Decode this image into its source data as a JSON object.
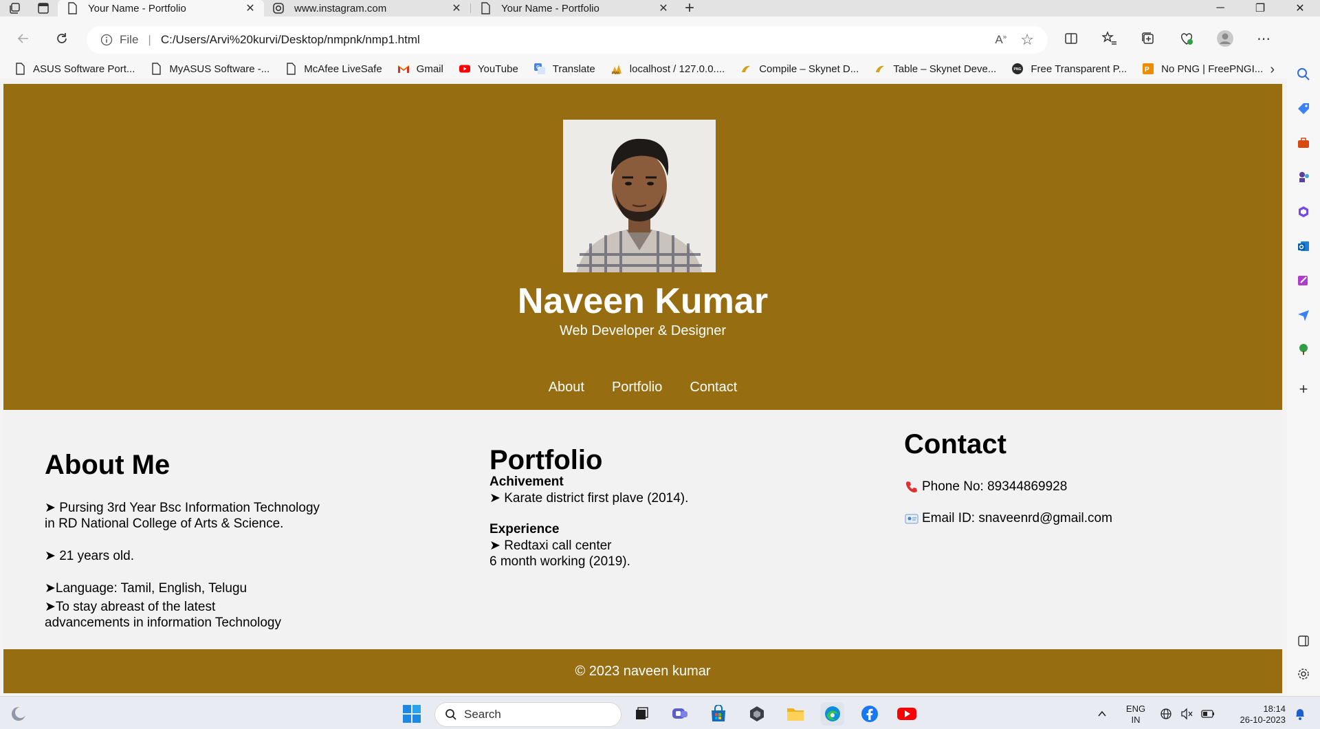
{
  "browser": {
    "tabs": [
      {
        "title": "Your Name - Portfolio",
        "active": true
      },
      {
        "title": "www.instagram.com",
        "active": false
      },
      {
        "title": "Your Name - Portfolio",
        "active": false
      }
    ],
    "address": {
      "scheme_label": "File",
      "url": "C:/Users/Arvi%20kurvi/Desktop/nmpnk/nmp1.html"
    },
    "bookmarks": [
      {
        "label": "ASUS Software Port...",
        "icon": "page-icon"
      },
      {
        "label": "MyASUS Software -...",
        "icon": "page-icon"
      },
      {
        "label": "McAfee LiveSafe",
        "icon": "page-icon"
      },
      {
        "label": "Gmail",
        "icon": "gmail-icon"
      },
      {
        "label": "YouTube",
        "icon": "youtube-icon"
      },
      {
        "label": "Translate",
        "icon": "translate-icon"
      },
      {
        "label": "localhost / 127.0.0....",
        "icon": "phpmyadmin-icon"
      },
      {
        "label": "Compile – Skynet D...",
        "icon": "skynet-icon"
      },
      {
        "label": "Table – Skynet Deve...",
        "icon": "skynet-icon"
      },
      {
        "label": "Free Transparent P...",
        "icon": "png-icon"
      },
      {
        "label": "No PNG | FreePNGI...",
        "icon": "freepngimg-icon"
      }
    ]
  },
  "page": {
    "hero": {
      "name": "Naveen Kumar",
      "subtitle": "Web Developer & Designer",
      "nav": [
        "About",
        "Portfolio",
        "Contact"
      ]
    },
    "about": {
      "heading": "About Me",
      "items": [
        [
          "➤ Pursing 3rd Year Bsc Information Technology",
          "in RD National College of Arts & Science."
        ],
        [
          "➤ 21 years old."
        ],
        [
          "➤Language: Tamil, English, Telugu"
        ],
        [
          "➤To stay abreast of the latest",
          "advancements in information Technology"
        ]
      ]
    },
    "portfolio": {
      "heading": "Portfolio",
      "achievement_title": "Achivement",
      "achievement_lines": [
        "➤ Karate district first plave (2014)."
      ],
      "experience_title": "Experience",
      "experience_lines": [
        "➤ Redtaxi call center",
        "6 month working (2019)."
      ]
    },
    "contact": {
      "heading": "Contact",
      "phone": "Phone No: 89344869928",
      "email": "Email ID: snaveenrd@gmail.com"
    },
    "footer": "© 2023 naveen kumar"
  },
  "taskbar": {
    "search_placeholder": "Search",
    "lang_line1": "ENG",
    "lang_line2": "IN",
    "time": "18:14",
    "date": "26-10-2023"
  },
  "colors": {
    "brand": "#976d12",
    "page_bg": "#f2f2f2"
  }
}
